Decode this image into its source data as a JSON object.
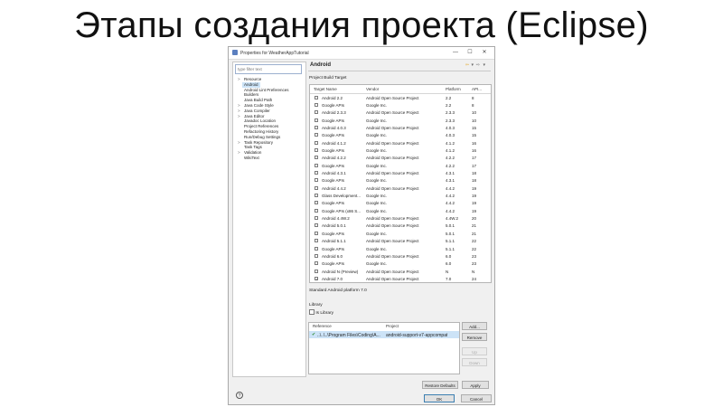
{
  "slide": {
    "title": "Этапы создания проекта (Eclipse)"
  },
  "window": {
    "title": "Properties for WeatherAppTutorial",
    "minimize_glyph": "—",
    "maximize_glyph": "☐",
    "close_glyph": "✕"
  },
  "sidebar": {
    "filter_placeholder": "type filter text",
    "items": [
      {
        "label": "Resource",
        "arrow": ">"
      },
      {
        "label": "Android",
        "arrow": ""
      },
      {
        "label": "Android Lint Preferences",
        "arrow": ""
      },
      {
        "label": "Builders",
        "arrow": ""
      },
      {
        "label": "Java Build Path",
        "arrow": ""
      },
      {
        "label": "Java Code Style",
        "arrow": ">"
      },
      {
        "label": "Java Compiler",
        "arrow": ">"
      },
      {
        "label": "Java Editor",
        "arrow": ">"
      },
      {
        "label": "Javadoc Location",
        "arrow": ""
      },
      {
        "label": "Project References",
        "arrow": ""
      },
      {
        "label": "Refactoring History",
        "arrow": ""
      },
      {
        "label": "Run/Debug Settings",
        "arrow": ""
      },
      {
        "label": "Task Repository",
        "arrow": ">"
      },
      {
        "label": "Task Tags",
        "arrow": ""
      },
      {
        "label": "Validation",
        "arrow": ">"
      },
      {
        "label": "WikiText",
        "arrow": ""
      }
    ],
    "selected_index": 1
  },
  "page": {
    "title": "Android",
    "nav_back": "⇦",
    "nav_dropdown": "▾",
    "nav_forward": "⇨",
    "build_target_label": "Project Build Target",
    "columns": [
      "Target Name",
      "Vendor",
      "Platform",
      "API..."
    ],
    "targets": [
      {
        "name": "Android 2.2",
        "vendor": "Android Open Source Project",
        "platform": "2.2",
        "api": "8",
        "checked": false
      },
      {
        "name": "Google APIs",
        "vendor": "Google Inc.",
        "platform": "2.2",
        "api": "8",
        "checked": false
      },
      {
        "name": "Android 2.3.3",
        "vendor": "Android Open Source Project",
        "platform": "2.3.3",
        "api": "10",
        "checked": false
      },
      {
        "name": "Google APIs",
        "vendor": "Google Inc.",
        "platform": "2.3.3",
        "api": "10",
        "checked": false
      },
      {
        "name": "Android 4.0.3",
        "vendor": "Android Open Source Project",
        "platform": "4.0.3",
        "api": "15",
        "checked": false
      },
      {
        "name": "Google APIs",
        "vendor": "Google Inc.",
        "platform": "4.0.3",
        "api": "15",
        "checked": false
      },
      {
        "name": "Android 4.1.2",
        "vendor": "Android Open Source Project",
        "platform": "4.1.2",
        "api": "16",
        "checked": false
      },
      {
        "name": "Google APIs",
        "vendor": "Google Inc.",
        "platform": "4.1.2",
        "api": "16",
        "checked": false
      },
      {
        "name": "Android 4.2.2",
        "vendor": "Android Open Source Project",
        "platform": "4.2.2",
        "api": "17",
        "checked": false
      },
      {
        "name": "Google APIs",
        "vendor": "Google Inc.",
        "platform": "4.2.2",
        "api": "17",
        "checked": false
      },
      {
        "name": "Android 4.3.1",
        "vendor": "Android Open Source Project",
        "platform": "4.3.1",
        "api": "18",
        "checked": false
      },
      {
        "name": "Google APIs",
        "vendor": "Google Inc.",
        "platform": "4.3.1",
        "api": "18",
        "checked": false
      },
      {
        "name": "Android 4.4.2",
        "vendor": "Android Open Source Project",
        "platform": "4.4.2",
        "api": "19",
        "checked": false
      },
      {
        "name": "Glass Development...",
        "vendor": "Google Inc.",
        "platform": "4.4.2",
        "api": "19",
        "checked": false
      },
      {
        "name": "Google APIs",
        "vendor": "Google Inc.",
        "platform": "4.4.2",
        "api": "19",
        "checked": false
      },
      {
        "name": "Google APIs (x86 S...",
        "vendor": "Google Inc.",
        "platform": "4.4.2",
        "api": "19",
        "checked": false
      },
      {
        "name": "Android 4.4W.2",
        "vendor": "Android Open Source Project",
        "platform": "4.4W.2",
        "api": "20",
        "checked": false
      },
      {
        "name": "Android 5.0.1",
        "vendor": "Android Open Source Project",
        "platform": "5.0.1",
        "api": "21",
        "checked": false
      },
      {
        "name": "Google APIs",
        "vendor": "Google Inc.",
        "platform": "5.0.1",
        "api": "21",
        "checked": false
      },
      {
        "name": "Android 5.1.1",
        "vendor": "Android Open Source Project",
        "platform": "5.1.1",
        "api": "22",
        "checked": false
      },
      {
        "name": "Google APIs",
        "vendor": "Google Inc.",
        "platform": "5.1.1",
        "api": "22",
        "checked": false
      },
      {
        "name": "Android 6.0",
        "vendor": "Android Open Source Project",
        "platform": "6.0",
        "api": "23",
        "checked": false
      },
      {
        "name": "Google APIs",
        "vendor": "Google Inc.",
        "platform": "6.0",
        "api": "23",
        "checked": false
      },
      {
        "name": "Android N (Preview)",
        "vendor": "Android Open Source Project",
        "platform": "N",
        "api": "N",
        "checked": false
      },
      {
        "name": "Android 7.0",
        "vendor": "Android Open Source Project",
        "platform": "7.0",
        "api": "24",
        "checked": true
      }
    ],
    "status_text": "Standard Android platform 7.0",
    "library_label": "Library",
    "is_library_label": "Is Library",
    "library_columns": [
      "Reference",
      "Project"
    ],
    "library_rows": [
      {
        "reference": "..\\..\\..\\Program Files\\Coding\\A...",
        "project": "android-support-v7-appcompat"
      }
    ],
    "library_buttons": {
      "add": "Add...",
      "remove": "Remove",
      "up": "Up",
      "down": "Down"
    }
  },
  "footer": {
    "help_glyph": "?",
    "restore_defaults": "Restore Defaults",
    "apply": "Apply",
    "ok": "OK",
    "cancel": "Cancel"
  },
  "colors": {
    "selection": "#cce3f7",
    "ok_green": "#2e8b2e",
    "nav_back": "#e3a117"
  }
}
